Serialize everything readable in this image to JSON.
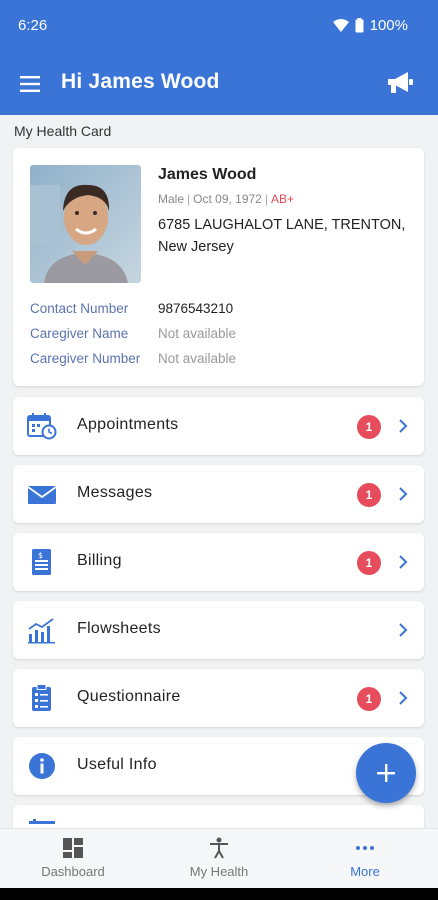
{
  "status_bar": {
    "time": "6:26",
    "battery": "100%"
  },
  "appbar": {
    "title": "Hi James Wood",
    "menu_icon": "hamburger-menu-icon",
    "action_icon": "megaphone-icon"
  },
  "section_label": "My Health Card",
  "profile": {
    "name": "James Wood",
    "gender": "Male",
    "dob": "Oct 09, 1972",
    "blood_group": "AB+",
    "address": "6785 LAUGHALOT LANE, TRENTON, New Jersey",
    "details": [
      {
        "label": "Contact Number",
        "value": "9876543210"
      },
      {
        "label": "Caregiver Name",
        "value": "Not available"
      },
      {
        "label": "Caregiver Number",
        "value": "Not available"
      }
    ]
  },
  "menu": [
    {
      "label": "Appointments",
      "badge": "1",
      "icon": "calendar-clock-icon"
    },
    {
      "label": "Messages",
      "badge": "1",
      "icon": "envelope-icon"
    },
    {
      "label": "Billing",
      "badge": "1",
      "icon": "bill-icon"
    },
    {
      "label": "Flowsheets",
      "badge": "",
      "icon": "chart-icon"
    },
    {
      "label": "Questionnaire",
      "badge": "1",
      "icon": "clipboard-icon"
    },
    {
      "label": "Useful Info",
      "badge": "",
      "icon": "info-icon"
    }
  ],
  "fab": {
    "icon": "plus-icon"
  },
  "bottom_nav": [
    {
      "label": "Dashboard",
      "icon": "dashboard-icon"
    },
    {
      "label": "My Health",
      "icon": "person-icon"
    },
    {
      "label": "More",
      "icon": "more-dots-icon",
      "active": true
    }
  ],
  "colors": {
    "primary": "#3a74d6",
    "badge": "#e64c5c",
    "blood_group": "#e04a55"
  }
}
